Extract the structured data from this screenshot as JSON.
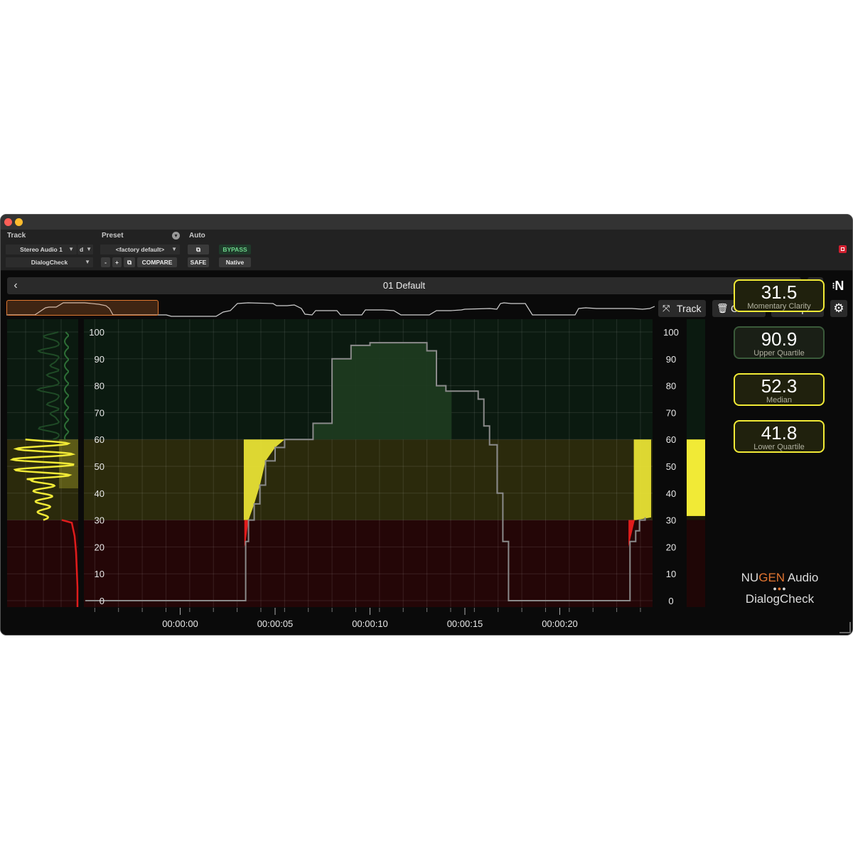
{
  "host": {
    "labels": {
      "track": "Track",
      "preset": "Preset",
      "auto": "Auto"
    },
    "track_name": "Stereo Audio 1",
    "track_suffix": "d",
    "insert_name": "DialogCheck",
    "preset_name": "<factory default>",
    "minus": "-",
    "plus": "+",
    "compare": "COMPARE",
    "bypass": "BYPASS",
    "safe": "SAFE",
    "native": "Native"
  },
  "plugin": {
    "preset_title": "01 Default",
    "help": "?",
    "logo_glyph": "N",
    "buttons": {
      "track": "Track",
      "clear": "Clear",
      "export": "Export"
    },
    "icons": [
      "chevron-left-icon",
      "chevron-right-icon",
      "help-icon",
      "nugen-logo-icon",
      "track-icon",
      "trash-icon",
      "export-icon",
      "gear-icon"
    ],
    "readouts": [
      {
        "value": "31.5",
        "label": "Momentary Clarity",
        "highlight": true
      },
      {
        "value": "90.9",
        "label": "Upper Quartile",
        "highlight": false
      },
      {
        "value": "52.3",
        "label": "Median",
        "highlight": true
      },
      {
        "value": "41.8",
        "label": "Lower Quartile",
        "highlight": true
      }
    ],
    "meter_level": 31.5,
    "brand": {
      "nu": "NU",
      "gen": "GEN",
      "audio": " Audio",
      "product": "DialogCheck"
    },
    "colors": {
      "yellow": "#f1ea36",
      "red": "#e01c1c",
      "green_zone": "#0b1a10",
      "yellow_zone": "#2b2a0c",
      "red_zone": "#240607",
      "orange": "#e37530"
    }
  },
  "chart_data": {
    "type": "line",
    "y_ticks": [
      "100",
      "90",
      "80",
      "70",
      "60",
      "50",
      "40",
      "30",
      "20",
      "10",
      "0"
    ],
    "ylim": [
      0,
      100
    ],
    "x_ticks": [
      "00:00:00",
      "00:00:05",
      "00:00:10",
      "00:00:15",
      "00:00:20"
    ],
    "zones": [
      {
        "name": "red",
        "from": 0,
        "to": 30
      },
      {
        "name": "yellow",
        "from": 30,
        "to": 60
      },
      {
        "name": "green",
        "from": 60,
        "to": 100
      }
    ],
    "series": [
      {
        "x": [
          -5,
          3.35,
          3.45,
          3.6,
          3.9,
          4.2,
          4.5,
          5.0,
          5.5,
          6.0,
          6.5,
          7.0,
          8.0,
          9.0,
          10.0,
          11.0,
          12.0,
          13.0,
          13.5,
          14.0,
          14.5,
          15.0,
          15.3,
          15.7,
          16.0,
          16.3,
          16.7,
          17.0,
          17.3,
          18.0,
          20.0,
          23.5,
          23.7,
          24.0,
          24.2,
          24.5
        ],
        "y": [
          0,
          0,
          22,
          30,
          36,
          43,
          52,
          57,
          60,
          60,
          60,
          66,
          90,
          95,
          96,
          96,
          96,
          93,
          80,
          78,
          78,
          78,
          78,
          75,
          65,
          58,
          40,
          22,
          0,
          0,
          0,
          0,
          22,
          26,
          30,
          31
        ]
      }
    ]
  }
}
